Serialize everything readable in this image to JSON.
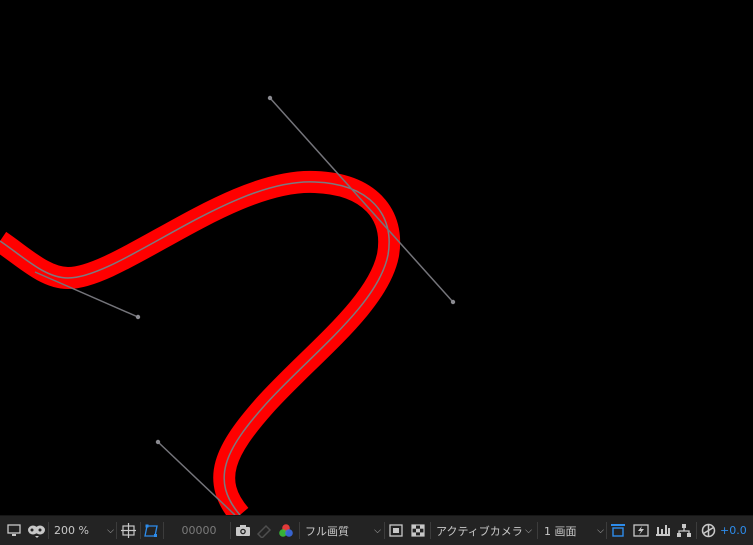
{
  "canvas": {
    "background": "#000000",
    "stroke_color": "#ff0000",
    "path_color": "#7a7a80",
    "handle_color": "#8a8a90"
  },
  "toolbar": {
    "zoom": "200 %",
    "timecode": "00000",
    "resolution": "フル画質",
    "camera": "アクティブカメラ",
    "views": "1 画面",
    "exposure": "+0.0",
    "accent": "#2d8ceb",
    "icons": [
      "display-icon",
      "mask-icon",
      "grid-icon",
      "region-icon",
      "snapshot-icon",
      "show-snapshot-icon",
      "channel-icon",
      "fast-preview-icon",
      "transparency-grid-icon",
      "toggle-view-icon",
      "timeline-icon",
      "flowchart-icon",
      "exposure-icon"
    ]
  }
}
